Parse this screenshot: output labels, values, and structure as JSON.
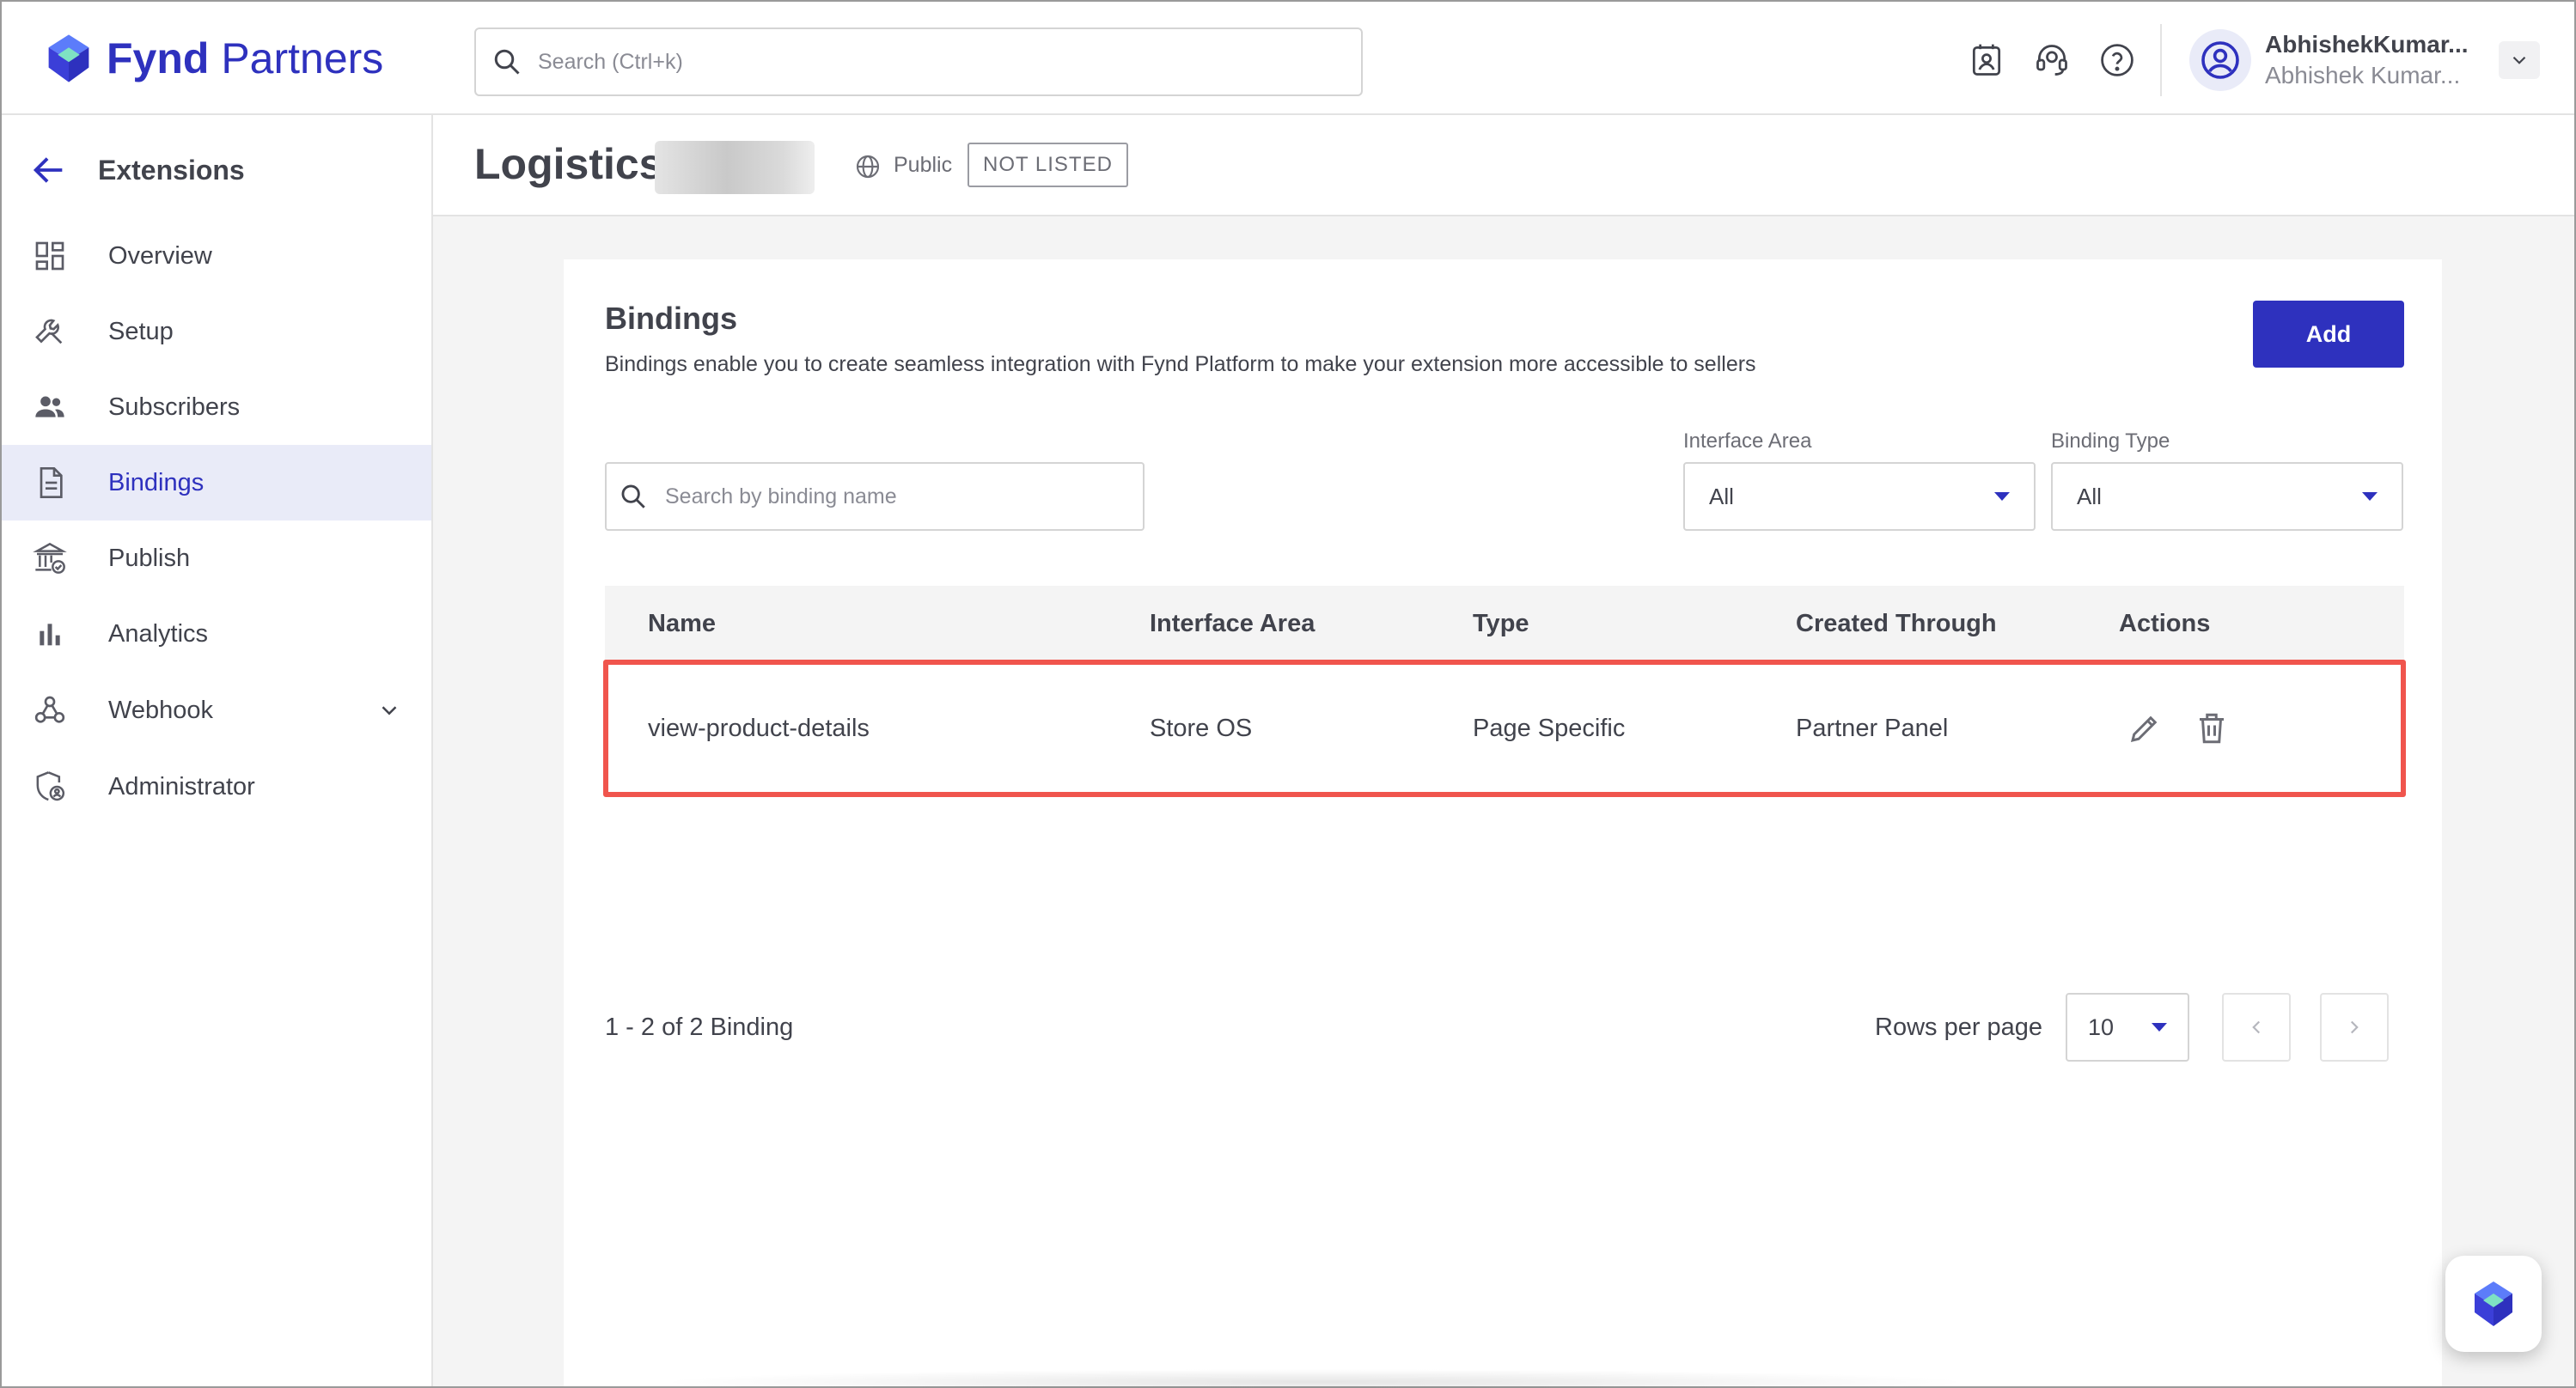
{
  "brand": {
    "name_bold": "Fynd",
    "name_rest": " Partners"
  },
  "search": {
    "placeholder": "Search (Ctrl+k)"
  },
  "topbar": {
    "icons": [
      "contact-card-icon",
      "support-headset-icon",
      "help-icon"
    ],
    "user": {
      "name": "AbhishekKumar...",
      "sub": "Abhishek Kumar..."
    }
  },
  "sidebar": {
    "title": "Extensions",
    "items": [
      {
        "label": "Overview",
        "icon": "dashboard-icon"
      },
      {
        "label": "Setup",
        "icon": "wrench-icon"
      },
      {
        "label": "Subscribers",
        "icon": "users-icon"
      },
      {
        "label": "Bindings",
        "icon": "document-icon",
        "active": true
      },
      {
        "label": "Publish",
        "icon": "bank-check-icon"
      },
      {
        "label": "Analytics",
        "icon": "bar-chart-icon"
      },
      {
        "label": "Webhook",
        "icon": "webhook-icon",
        "expandable": true
      },
      {
        "label": "Administrator",
        "icon": "admin-shield-icon"
      }
    ]
  },
  "header": {
    "title": "Logistics",
    "visibility": "Public",
    "listing_badge": "NOT LISTED"
  },
  "bindings": {
    "title": "Bindings",
    "description": "Bindings enable you to create seamless integration with Fynd Platform to make your extension more accessible to sellers",
    "add_label": "Add",
    "search_placeholder": "Search by binding name",
    "filters": {
      "interface_area": {
        "label": "Interface Area",
        "value": "All"
      },
      "binding_type": {
        "label": "Binding Type",
        "value": "All"
      }
    },
    "table": {
      "columns": [
        "Name",
        "Interface Area",
        "Type",
        "Created Through",
        "Actions"
      ],
      "rows": [
        {
          "name": "view-product-details",
          "interface_area": "Store OS",
          "type": "Page Specific",
          "created_through": "Partner Panel"
        }
      ]
    },
    "pagination": {
      "summary": "1 - 2 of 2 Binding",
      "rows_per_page_label": "Rows per page",
      "rows_per_page": "10"
    }
  },
  "colors": {
    "accent": "#2e31be",
    "highlight": "#f0554d",
    "active_bg": "#e9ebf8"
  }
}
